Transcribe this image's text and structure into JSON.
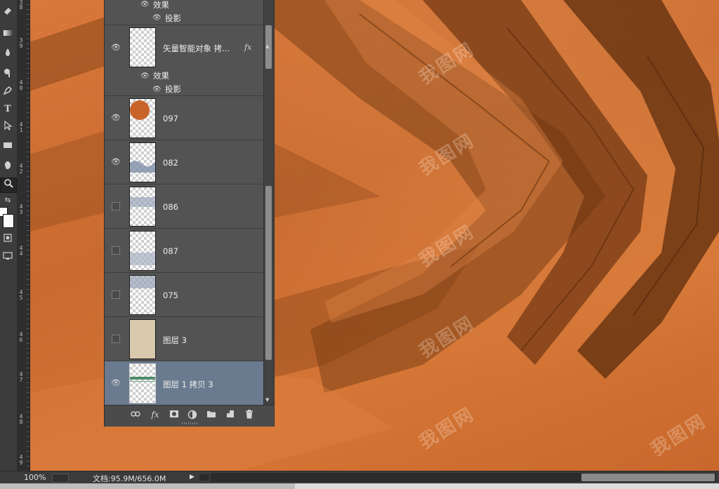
{
  "toolbar": {
    "tools": [
      "eraser-icon",
      "gradient-icon",
      "blur-icon",
      "dodge-icon",
      "pen-icon",
      "type-icon",
      "path-select-icon",
      "rectangle-icon",
      "hand-icon",
      "zoom-icon"
    ],
    "type_tool_glyph": "T"
  },
  "ruler": {
    "labels": [
      "3",
      "8",
      "3",
      "9",
      "4",
      "0",
      "4",
      "1",
      "4",
      "2",
      "4",
      "3",
      "4",
      "4",
      "4",
      "5",
      "4",
      "6",
      "4",
      "7",
      "4",
      "8",
      "4",
      "9"
    ]
  },
  "layers_panel": {
    "top_effects": {
      "effects_label": "效果",
      "shadow_label": "投影"
    },
    "layers": [
      {
        "name": "矢量智能对象 拷...",
        "fx": "fx",
        "effects_label": "效果",
        "shadow_label": "投影",
        "visible": true
      },
      {
        "name": "097",
        "visible": true
      },
      {
        "name": "082",
        "visible": true
      },
      {
        "name": "086",
        "visible": false
      },
      {
        "name": "087",
        "visible": false
      },
      {
        "name": "075",
        "visible": false
      },
      {
        "name": "图层 3",
        "visible": false
      },
      {
        "name": "图层 1 拷贝 3",
        "visible": true,
        "selected": true
      }
    ],
    "footer_icons": [
      "link-icon",
      "fx-icon",
      "mask-icon",
      "adjustment-icon",
      "folder-icon",
      "new-layer-icon",
      "trash-icon"
    ],
    "footer_fx_label": "fx"
  },
  "status_bar": {
    "zoom": "100%",
    "doc_size": "文档:95.9M/656.0M"
  },
  "canvas": {
    "watermark_text": "我图网"
  },
  "colors": {
    "canvas_orange": "#d8783a",
    "panel_bg": "#535353",
    "selected_row": "#6b7b8f"
  }
}
